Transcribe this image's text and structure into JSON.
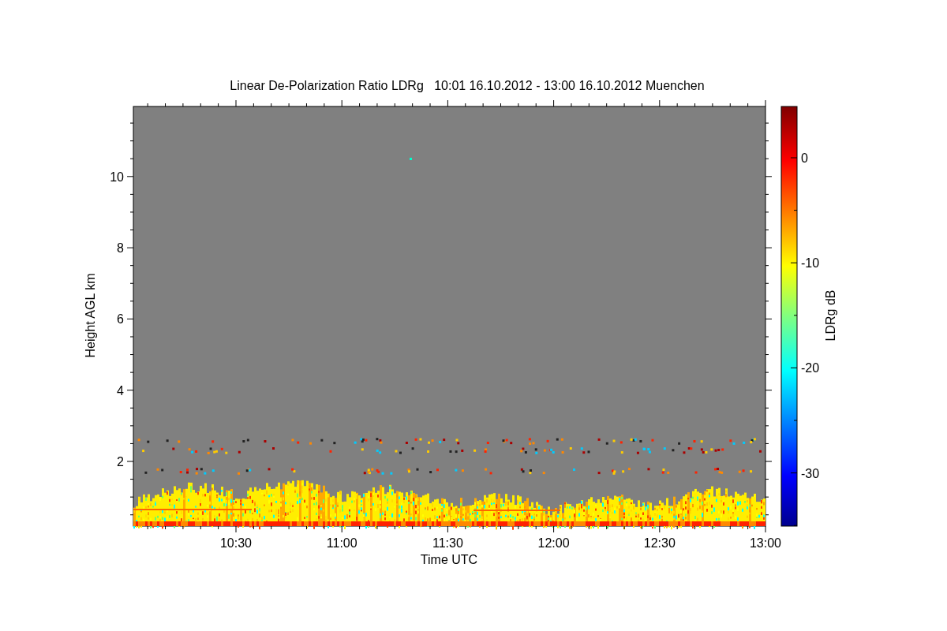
{
  "title": "Linear De-Polarization Ratio LDRg   10:01 16.10.2012 - 13:00 16.10.2012 Muenchen",
  "y_axis": {
    "label": "Height AGL km",
    "ticks": [
      "10",
      "8",
      "6",
      "4",
      "2"
    ]
  },
  "x_axis": {
    "label": "Time UTC",
    "ticks": [
      "10:30",
      "11:00",
      "11:30",
      "12:00",
      "12:30",
      "13:00"
    ]
  },
  "colorbar": {
    "label": "LDRg dB",
    "ticks": [
      "0",
      "-10",
      "-20",
      "-30"
    ]
  }
}
